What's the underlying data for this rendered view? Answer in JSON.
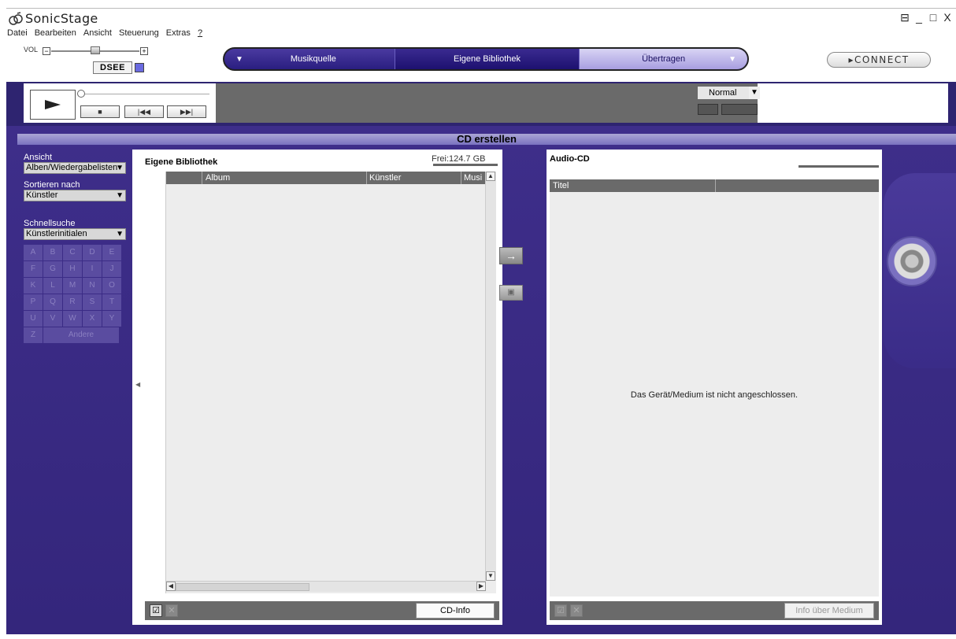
{
  "app": {
    "title": "SonicStage",
    "window_controls": [
      "⊟",
      "_",
      "□",
      "X"
    ]
  },
  "menu": [
    "Datei",
    "Bearbeiten",
    "Ansicht",
    "Steuerung",
    "Extras",
    "?"
  ],
  "volume": {
    "label": "VOL",
    "minus": "−",
    "plus": "+",
    "level": 0.5
  },
  "dsee": {
    "label": "DSEE"
  },
  "nav": {
    "source": "Musikquelle",
    "library": "Eigene Bibliothek",
    "transfer": "Übertragen"
  },
  "connect": {
    "label": "▸CONNECT"
  },
  "player": {
    "mode": "Normal",
    "mode_arrow": "▼"
  },
  "section": {
    "title": "CD erstellen"
  },
  "sidebar": {
    "view_label": "Ansicht",
    "view_value": "Alben/Wiedergabelisten",
    "sort_label": "Sortieren nach",
    "sort_value": "Künstler",
    "quick_label": "Schnellsuche",
    "quick_value": "Künstlerinitialen",
    "letters": [
      "A",
      "B",
      "C",
      "D",
      "E",
      "F",
      "G",
      "H",
      "I",
      "J",
      "K",
      "L",
      "M",
      "N",
      "O",
      "P",
      "Q",
      "R",
      "S",
      "T",
      "U",
      "V",
      "W",
      "X",
      "Y"
    ],
    "letter_z": "Z",
    "letter_other": "Andere"
  },
  "library": {
    "title": "Eigene Bibliothek",
    "free": "Frei:124.7  GB",
    "columns": {
      "album": "Album",
      "artist": "Künstler",
      "music": "Musi"
    },
    "cdinfo_button": "CD-Info"
  },
  "audiocd": {
    "title": "Audio-CD",
    "column_title": "Titel",
    "message": "Das Gerät/Medium ist nicht angeschlossen.",
    "info_button": "Info über Medium"
  },
  "colors": {
    "main_bg": "#3e2e8a",
    "nav_active": "#a89ee0",
    "panel_header": "#6a6a6a"
  }
}
